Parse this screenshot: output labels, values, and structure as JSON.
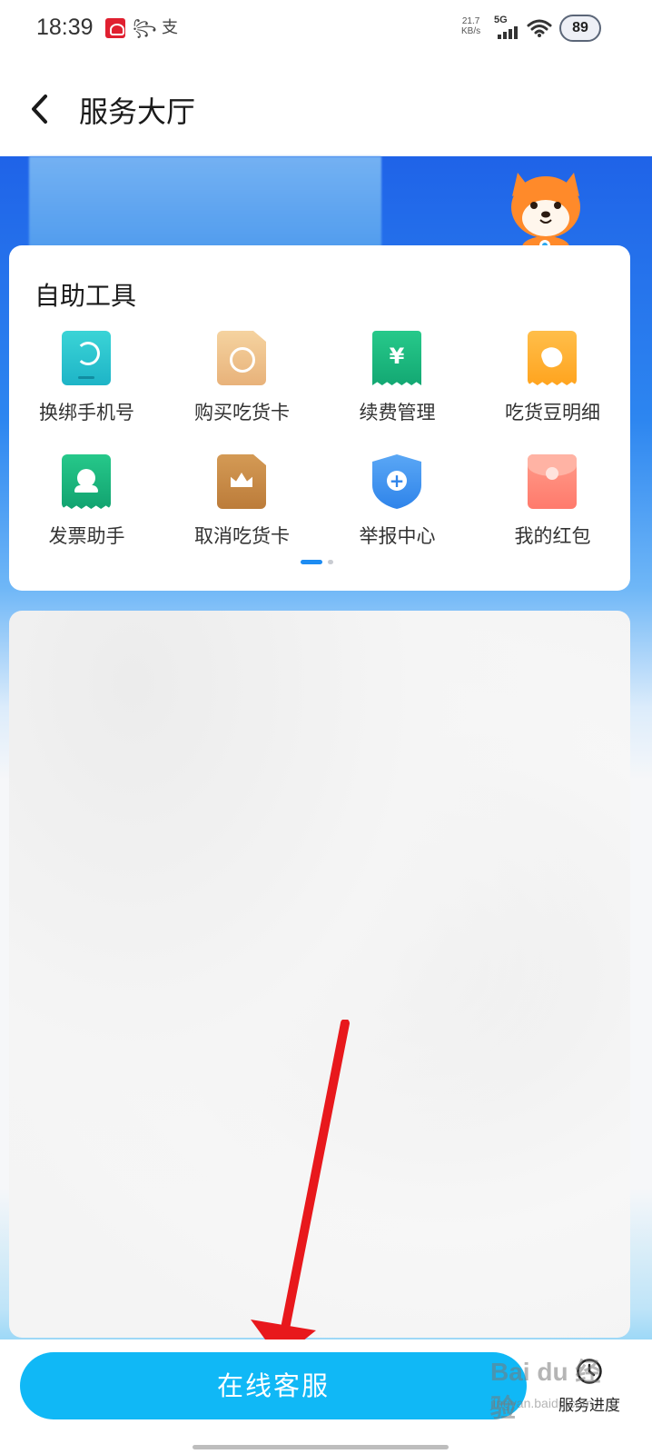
{
  "status_bar": {
    "time": "18:39",
    "notif_2_glyph": "꧂",
    "notif_3_glyph": "支",
    "net_speed_value": "21.7",
    "net_speed_unit": "KB/s",
    "network": "5G",
    "battery": "89"
  },
  "header": {
    "back_icon": "chevron-left-icon",
    "title": "服务大厅"
  },
  "tools": {
    "title": "自助工具",
    "items": [
      {
        "label": "换绑手机号",
        "icon": "phone-rebind-icon"
      },
      {
        "label": "购买吃货卡",
        "icon": "buy-card-icon"
      },
      {
        "label": "续费管理",
        "icon": "renewal-icon",
        "glyph": "¥"
      },
      {
        "label": "吃货豆明细",
        "icon": "bean-detail-icon"
      },
      {
        "label": "发票助手",
        "icon": "invoice-icon"
      },
      {
        "label": "取消吃货卡",
        "icon": "cancel-card-icon"
      },
      {
        "label": "举报中心",
        "icon": "report-shield-icon",
        "glyph": "+"
      },
      {
        "label": "我的红包",
        "icon": "red-packet-icon"
      }
    ],
    "pager": {
      "current": 1,
      "total": 2
    }
  },
  "bottom_bar": {
    "online_service_label": "在线客服",
    "progress_label": "服务进度",
    "progress_icon": "clock-icon"
  },
  "watermark": {
    "main": "Bai du 经验",
    "sub": "jingyan.baidu.com"
  },
  "colors": {
    "accent_blue": "#10b8f6",
    "hero_blue": "#1f63e8",
    "annotation_red": "#e8181c"
  }
}
